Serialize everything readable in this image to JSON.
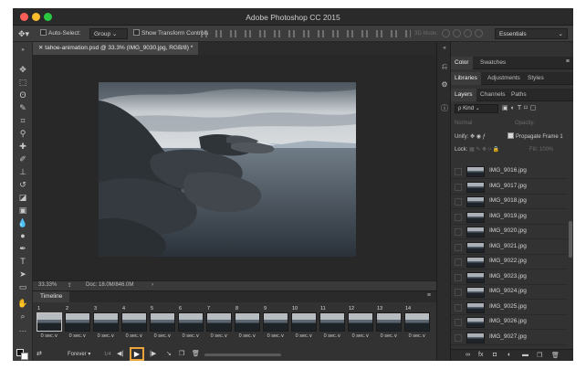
{
  "window": {
    "title": "Adobe Photoshop CC 2015"
  },
  "options_bar": {
    "move_icon": "move-icon",
    "auto_select_label": "Auto-Select:",
    "auto_select_value": "Group",
    "show_transform_label": "Show Transform Controls",
    "mode_3d_label": "3D Mode:",
    "workspace": "Essentials"
  },
  "document": {
    "tab_title": "tahoe-animation.psd @ 33.3% (IMG_9030.jpg, RGB/8) *",
    "zoom": "33.33%",
    "doc_info": "Doc: 18.0M/846.0M"
  },
  "tools": [
    "move-icon",
    "marquee-icon",
    "lasso-icon",
    "quick-select-icon",
    "crop-icon",
    "eyedropper-icon",
    "healing-icon",
    "brush-icon",
    "stamp-icon",
    "history-brush-icon",
    "eraser-icon",
    "gradient-icon",
    "blur-icon",
    "dodge-icon",
    "pen-icon",
    "type-icon",
    "path-select-icon",
    "shape-icon",
    "hand-icon",
    "zoom-icon",
    "more-icon"
  ],
  "timeline": {
    "tab": "Timeline",
    "frames": [
      {
        "num": "1",
        "delay": "0 sec.∨"
      },
      {
        "num": "2",
        "delay": "0 sec.∨"
      },
      {
        "num": "3",
        "delay": "0 sec.∨"
      },
      {
        "num": "4",
        "delay": "0 sec.∨"
      },
      {
        "num": "5",
        "delay": "0 sec.∨"
      },
      {
        "num": "6",
        "delay": "0 sec.∨"
      },
      {
        "num": "7",
        "delay": "0 sec.∨"
      },
      {
        "num": "8",
        "delay": "0 sec.∨"
      },
      {
        "num": "9",
        "delay": "0 sec.∨"
      },
      {
        "num": "10",
        "delay": "0 sec.∨"
      },
      {
        "num": "11",
        "delay": "0 sec.∨"
      },
      {
        "num": "12",
        "delay": "0 sec.∨"
      },
      {
        "num": "13",
        "delay": "0 sec.∨"
      },
      {
        "num": "14",
        "delay": "0 sec.∨"
      }
    ],
    "loop": "Forever",
    "play_symbol": "▶",
    "counter": "1/4"
  },
  "panels": {
    "top_tabs": [
      "Color",
      "Swatches"
    ],
    "mid_tabs": [
      "Libraries",
      "Adjustments",
      "Styles"
    ],
    "layer_tabs": [
      "Layers",
      "Channels",
      "Paths"
    ],
    "kind_label": "ρ Kind",
    "blend_mode": "Normal",
    "opacity_label": "Opacity:",
    "unify_label": "Unify:",
    "propagate_label": "Propagate Frame 1",
    "lock_label": "Lock:",
    "fill_label": "Fill:",
    "fill_value": "100%",
    "layers": [
      "IMG_9016.jpg",
      "IMG_9017.jpg",
      "IMG_9018.jpg",
      "IMG_9019.jpg",
      "IMG_9020.jpg",
      "IMG_9021.jpg",
      "IMG_9022.jpg",
      "IMG_9023.jpg",
      "IMG_9024.jpg",
      "IMG_9025.jpg",
      "IMG_9026.jpg",
      "IMG_9027.jpg"
    ]
  },
  "colors": {
    "accent_highlight": "#e9a53b",
    "chrome_dark": "#323232",
    "canvas_bg": "#282828"
  }
}
